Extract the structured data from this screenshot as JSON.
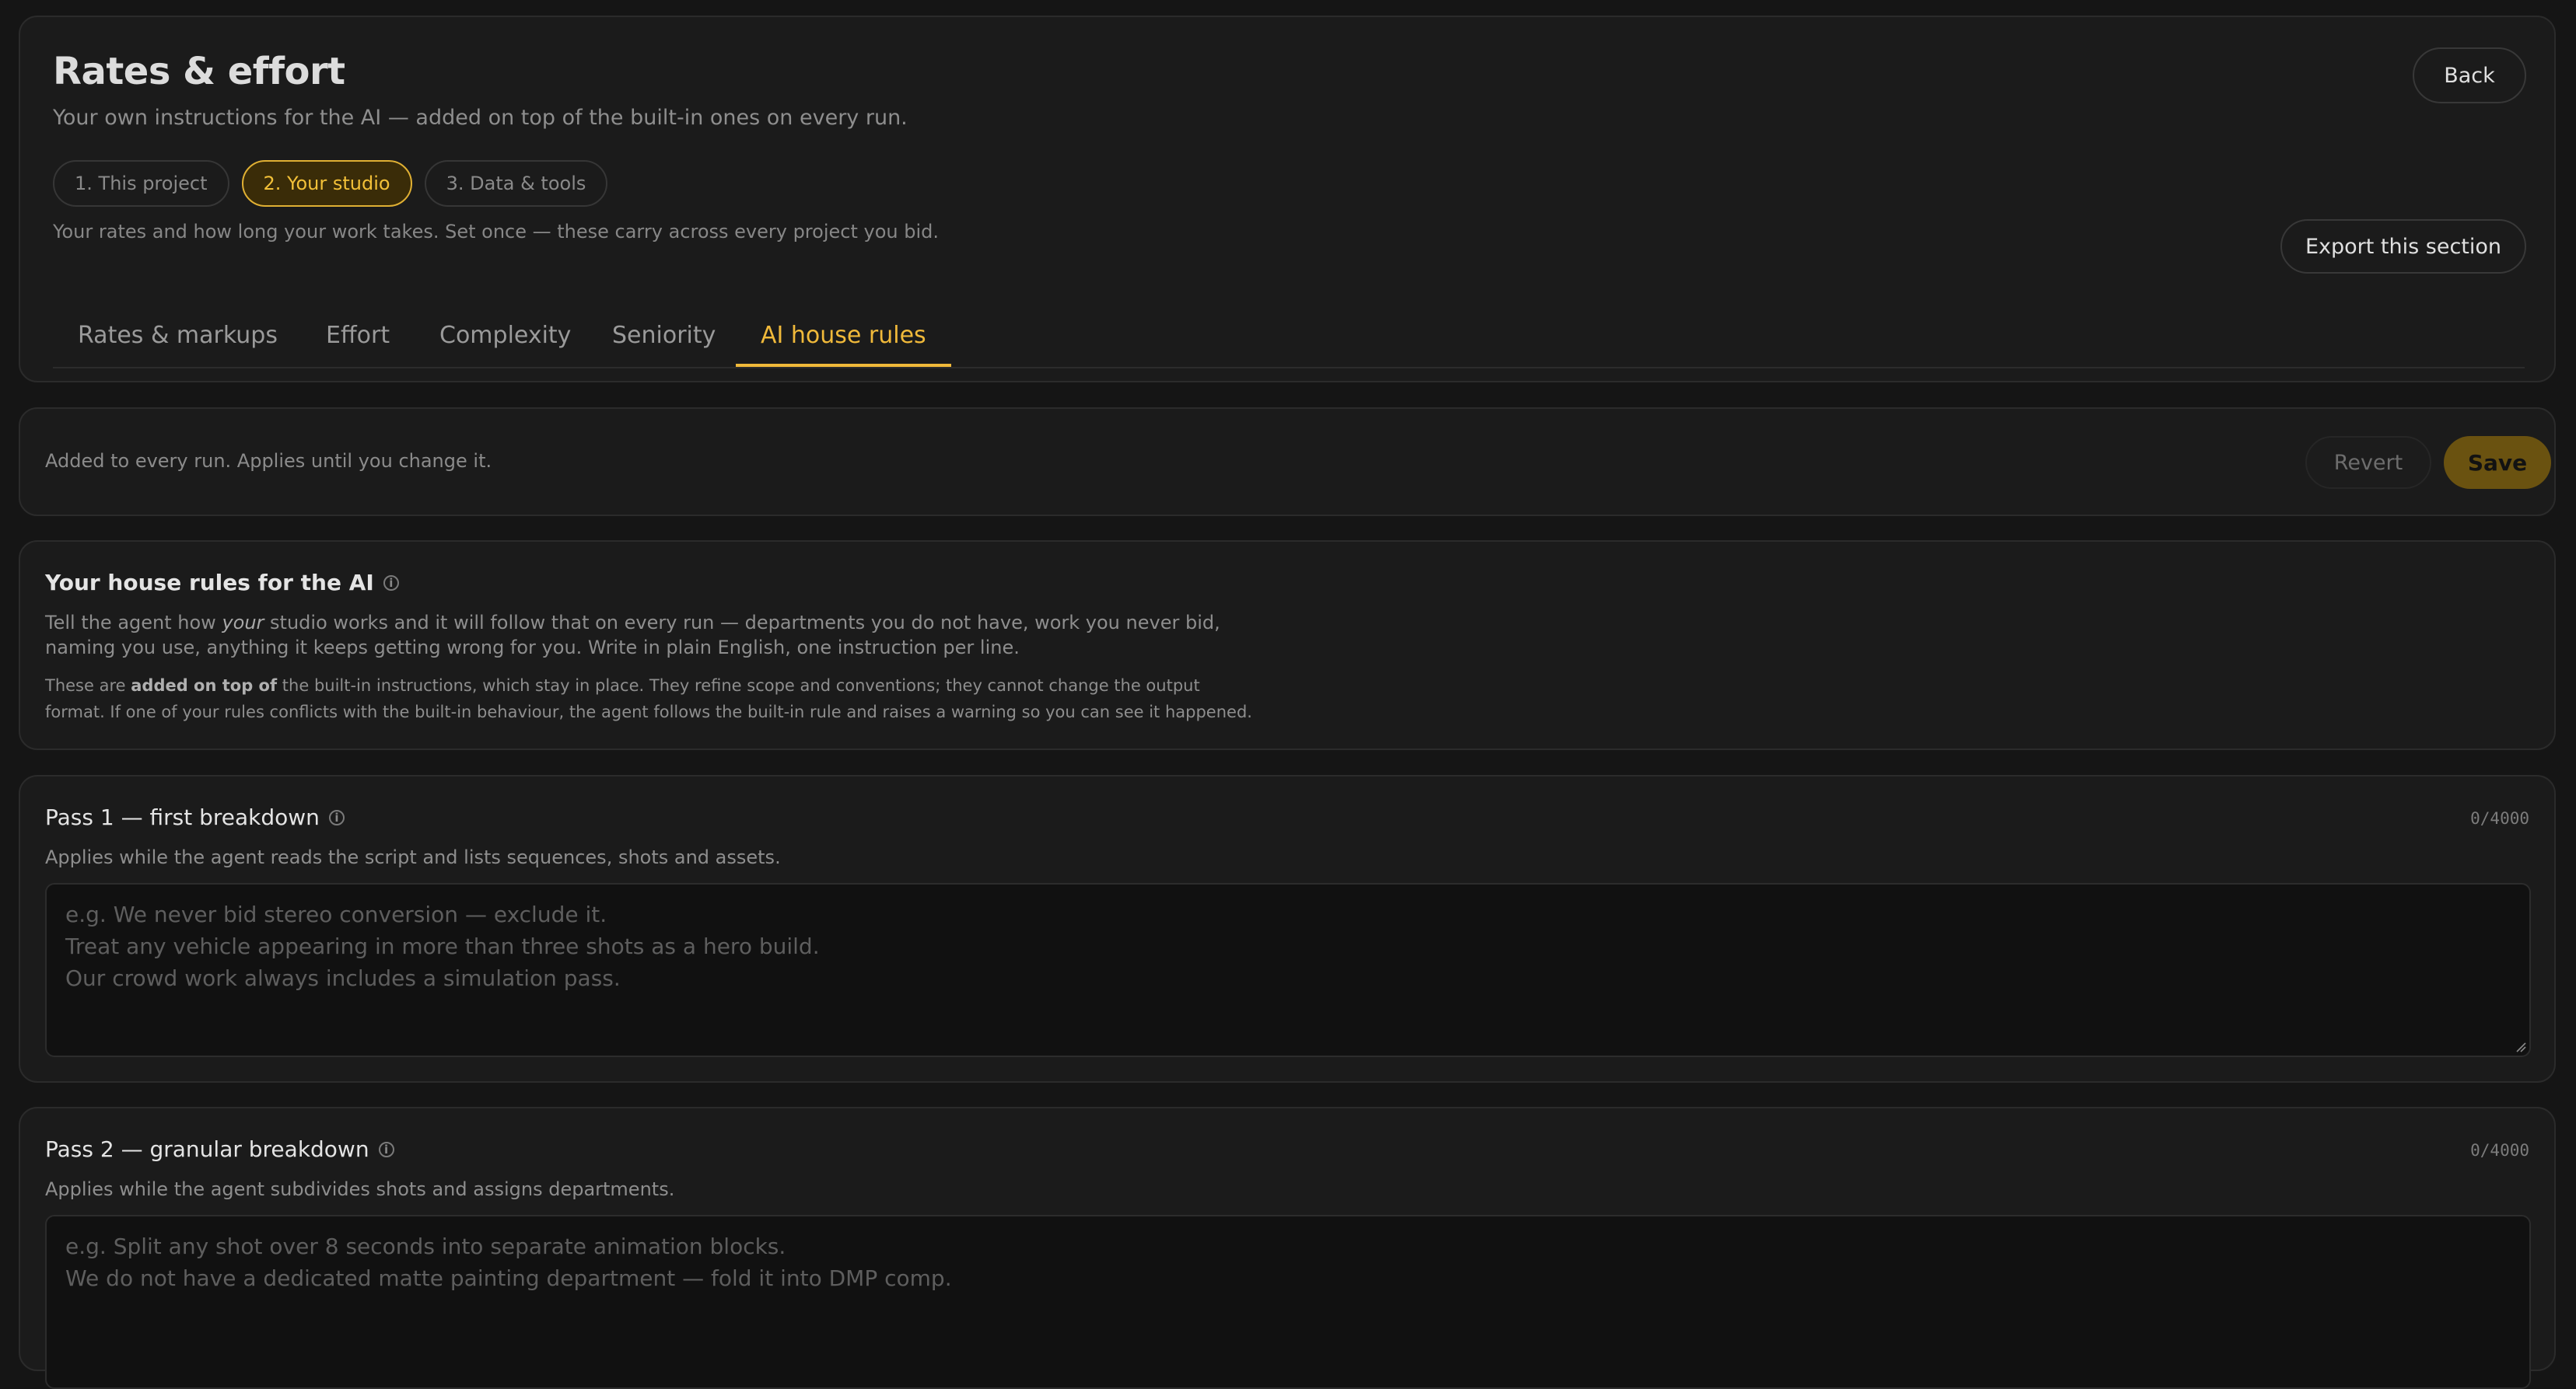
{
  "header": {
    "title": "Rates & effort",
    "subtitle": "Your own instructions for the AI — added on top of the built-in ones on every run.",
    "back_label": "Back",
    "export_label": "Export this section",
    "steps": [
      {
        "label": "1. This project",
        "active": false
      },
      {
        "label": "2. Your studio",
        "active": true
      },
      {
        "label": "3. Data & tools",
        "active": false
      }
    ],
    "step_description": "Your rates and how long your work takes. Set once — these carry across every project you bid.",
    "tabs": [
      {
        "label": "Rates & markups",
        "active": false
      },
      {
        "label": "Effort",
        "active": false
      },
      {
        "label": "Complexity",
        "active": false
      },
      {
        "label": "Seniority",
        "active": false
      },
      {
        "label": "AI house rules",
        "active": true
      }
    ]
  },
  "save_bar": {
    "hint": "Added to every run. Applies until you change it.",
    "revert_label": "Revert",
    "save_label": "Save"
  },
  "house_rules": {
    "title": "Your house rules for the AI",
    "para1_a": "Tell the agent how ",
    "para1_em": "your",
    "para1_b": " studio works and it will follow that on every run — departments you do not have, work you never bid, naming you use, anything it keeps getting wrong for you. Write in plain English, one instruction per line.",
    "para2_a": "These are ",
    "para2_b": "added on top of",
    "para2_c": " the built-in instructions, which stay in place. They refine scope and conventions; they cannot change the output format. If one of your rules conflicts with the built-in behaviour, the agent follows the built-in rule and raises a warning so you can see it happened."
  },
  "passes": [
    {
      "title": "Pass 1 — first breakdown",
      "counter": "0/4000",
      "description": "Applies while the agent reads the script and lists sequences, shots and assets.",
      "placeholder_lines": [
        "e.g. We never bid stereo conversion — exclude it.",
        "Treat any vehicle appearing in more than three shots as a hero build.",
        "Our crowd work always includes a simulation pass."
      ]
    },
    {
      "title": "Pass 2 — granular breakdown",
      "counter": "0/4000",
      "description": "Applies while the agent subdivides shots and assigns departments.",
      "placeholder_lines": [
        "e.g. Split any shot over 8 seconds into separate animation blocks.",
        "We do not have a dedicated matte painting department — fold it into DMP comp."
      ]
    }
  ],
  "colors": {
    "accent": "#f0b93a",
    "background": "#151515",
    "card": "#1b1b1b",
    "save_button": "#6a5210"
  }
}
